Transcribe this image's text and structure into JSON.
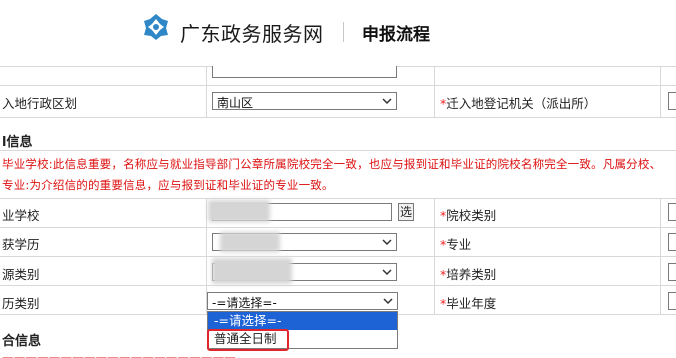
{
  "header": {
    "site_title": "广东政务服务网",
    "page_subtitle": "申报流程"
  },
  "form": {
    "row_district": {
      "label": "入地行政区划",
      "select_value": "南山区",
      "right_label": "迁入地登记机关（派出所）"
    },
    "section_graduate": {
      "title": "l信息",
      "notice_line1": "毕业学校:此信息重要，名称应与就业指导部门公章所属院校完全一致，也应与报到证和毕业证的院校名称完全一致。凡属分校、",
      "notice_line2": "专业:为介绍信的的重要信息，应与报到证和毕业证的专业一致。"
    },
    "row_school": {
      "label": "业学校",
      "pick_label": "选",
      "right_label": "院校类别"
    },
    "row_degree": {
      "label": "获学历",
      "right_label": "专业"
    },
    "row_source": {
      "label": "源类别",
      "right_label": "培养类别"
    },
    "row_study_type": {
      "label": "历类别",
      "select_value": "-=请选择=-",
      "right_label": "毕业年度"
    },
    "section_other": {
      "title": "合信息"
    }
  },
  "dropdown": {
    "options": [
      "-=请选择=-",
      "普通全日制"
    ],
    "selected_index": 0,
    "highlighted_index": 1
  },
  "colors": {
    "required_marker": "#ee2222",
    "notice_text": "#dd1111",
    "highlight_border": "#e0262a",
    "selected_option_bg": "#1e63d6",
    "logo_blue": "#2f87c8"
  },
  "icons": {
    "logo": "gd-gov-logo-icon",
    "select_arrow": "chevron-down-icon"
  }
}
